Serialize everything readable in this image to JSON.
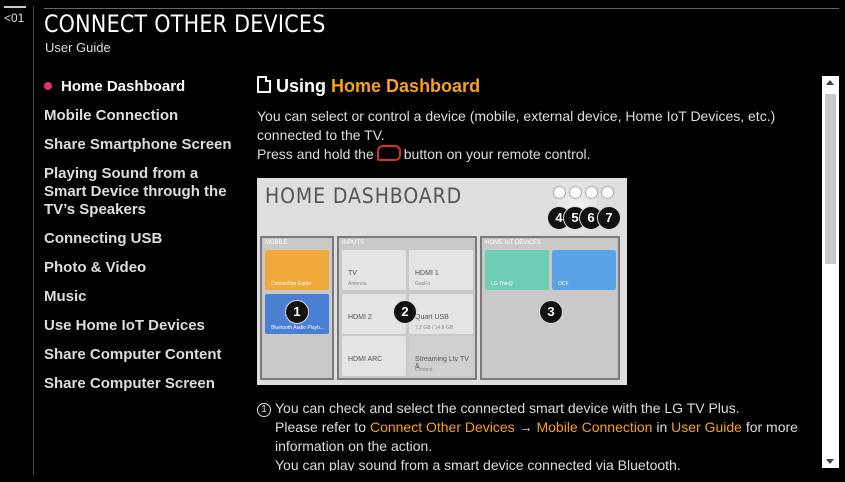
{
  "nav": {
    "back_label": "<01"
  },
  "header": {
    "title": "CONNECT OTHER DEVICES",
    "subtitle": "User Guide"
  },
  "sidebar": {
    "items": [
      {
        "label": "Home Dashboard",
        "active": true
      },
      {
        "label": "Mobile Connection"
      },
      {
        "label": "Share Smartphone Screen"
      },
      {
        "label": "Playing Sound from a Smart Device through the TV’s Speakers"
      },
      {
        "label": "Connecting USB"
      },
      {
        "label": "Photo & Video"
      },
      {
        "label": "Music"
      },
      {
        "label": "Use Home IoT Devices"
      },
      {
        "label": "Share Computer Content"
      },
      {
        "label": "Share Computer Screen"
      }
    ]
  },
  "main": {
    "heading_prefix": "Using",
    "heading_accent": "Home Dashboard",
    "intro": "You can select or control a device (mobile, external device, Home IoT Devices, etc.) connected to the TV.",
    "press_before": "Press and hold the",
    "press_after": "button on your remote control.",
    "screenshot": {
      "title": "HOME DASHBOARD",
      "mobile_label": "MOBILE",
      "inputs_label": "INPUTS",
      "iot_label": "HOME IoT DEVICES",
      "tiles": {
        "connection_guide": "Connection Guide",
        "bluetooth": "Bluetooth Audio Playb...",
        "tv": "TV",
        "tv_sub": "Antenna",
        "hdmi1": "HDMI 1",
        "hdmi1_sub": "GasFo",
        "hdmi2": "HDMI 2",
        "usb": "Quart USB",
        "usb_sub": "7.2 GB / 14.8 GB",
        "hdmi_arc": "HDMI ARC",
        "streaming": "Streaming Ltv TV &",
        "streaming_sub": "Content",
        "iot1": "LG ThinQ",
        "iot2": "OCF"
      },
      "markers": [
        "1",
        "2",
        "3",
        "4",
        "5",
        "6",
        "7"
      ]
    },
    "caption": {
      "number": "1",
      "line1": "You can check and select the connected smart device with the LG TV Plus.",
      "refer_before": "Please refer to",
      "link1": "Connect Other Devices",
      "arrow": "→",
      "link2": "Mobile Connection",
      "in_word": "in",
      "link3": "User Guide",
      "refer_after": "for more",
      "line3": "information on the action.",
      "line4": "You can play sound from a smart device connected via Bluetooth."
    }
  },
  "colors": {
    "accent": "#f7a11a",
    "active_dot": "#e0336f",
    "remote_icon": "#d9342b",
    "mobile_tile": "#f2a93b",
    "bt_tile": "#4a7fd4",
    "iot1_tile": "#6ecfb6",
    "iot2_tile": "#5aa3e6"
  }
}
